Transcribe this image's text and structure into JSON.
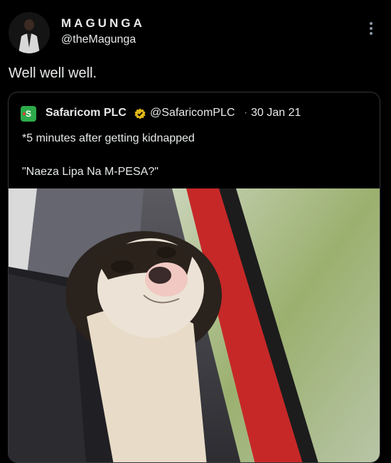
{
  "tweet": {
    "author_name": "MAGUNGA",
    "author_handle": "@theMagunga",
    "text": "Well well well."
  },
  "quoted": {
    "author_name": "Safaricom PLC",
    "author_handle": "@SafaricomPLC",
    "separator": "·",
    "date": "30 Jan 21",
    "line1": "*5 minutes after getting kidnapped",
    "line2": "\"Naeza Lipa Na M-PESA?\"",
    "logo_letter": "S"
  },
  "icons": [
    "more-icon",
    "verified-badge-icon",
    "safaricom-logo-icon"
  ],
  "colors": {
    "background": "#000000",
    "text": "#e7e9ea",
    "muted": "#8b98a5",
    "border": "#333639",
    "verified_gold": "#e2b719",
    "safaricom_green": "#2eaa4a"
  }
}
